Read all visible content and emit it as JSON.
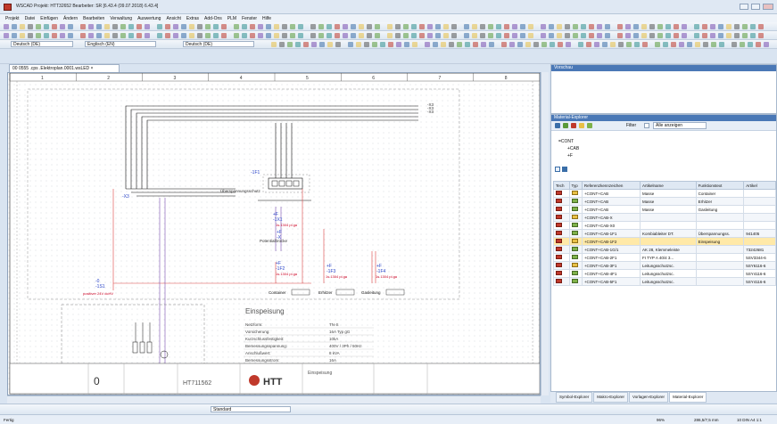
{
  "window": {
    "title": "WSCAD Projekt: HTT32652  Bearbeiter: SR [6.43.4 (09.07.2018) 6.43.4]"
  },
  "menu": [
    "Projekt",
    "Datei",
    "Einfügen",
    "Ändern",
    "Bearbeiten",
    "Verwaltung",
    "Auswertung",
    "Ansicht",
    "Extras",
    "Add-Ons",
    "PLM",
    "Fenster",
    "Hilfe"
  ],
  "toolbar": {
    "lang1": "Deutsch (DE)",
    "lang2": "Englisch (EN)",
    "lang3": "Deutsch (DE)",
    "style": "Standard"
  },
  "doc_tab": {
    "label": "00 0555 .cps .Elektroplan.0001.wsLED ×"
  },
  "column_numbers": [
    "1",
    "2",
    "3",
    "4",
    "5",
    "6",
    "7",
    "8"
  ],
  "schematic": {
    "cabinet_label": "Überspannungsschutz",
    "potential_label": "Potentialbrücke",
    "labels": [
      "-X3",
      "-1F1",
      "-1F2",
      "-1F3",
      "-1F4",
      "-10",
      "-X",
      "+F",
      "+F1",
      "+F2",
      "Container",
      "Erhitzer",
      "Gasleitung"
    ],
    "terminal_text": "positiver 24V dcHV",
    "cross_refs": [
      "1s.1304 pl.ga",
      "1s.1304 pl.ga",
      "1s.1304 pl.ga"
    ],
    "legend_title": "Einspeisung",
    "legend_rows": [
      {
        "k": "Netzform:",
        "v": "TN-S"
      },
      {
        "k": "Vorsicherung:",
        "v": "16A  Typ gG"
      },
      {
        "k": "Kurzschlussfestigkeit:",
        "v": "10kA"
      },
      {
        "k": "Bemessungsspannung:",
        "v": "400V / 3Ph / 50Hz"
      },
      {
        "k": "Anschlußwert:",
        "v": "8 kVA"
      },
      {
        "k": "Bemessungsstrom:",
        "v": "16A"
      }
    ],
    "titleblock": {
      "drawing_no": "HT711562",
      "rev": "0",
      "company": "HTT",
      "doc": "Einspeisung"
    }
  },
  "panels": {
    "preview": {
      "title": "Vorschau"
    },
    "material": {
      "title": "Material-Explorer",
      "filter_label": "Filter",
      "show_all": "Alle anzeigen",
      "tree": [
        "=CONT",
        "+CAB",
        "+F"
      ],
      "columns": [
        "Tech",
        "Typ",
        "Referenzkennzeichen",
        "Artikelname",
        "Funktionstext",
        "Artikel"
      ],
      "rows": [
        {
          "ref": "+CONT+CAB",
          "name": "Masse",
          "func": "Container",
          "art": ""
        },
        {
          "ref": "+CONT+CAB",
          "name": "Masse",
          "func": "Erhitzer",
          "art": ""
        },
        {
          "ref": "+CONT+CAB",
          "name": "Masse",
          "func": "Gasleitung",
          "art": ""
        },
        {
          "ref": "+CONT+CAB-X",
          "name": "",
          "func": "",
          "art": ""
        },
        {
          "ref": "+CONT+CAB-X0",
          "name": "",
          "func": "",
          "art": ""
        },
        {
          "ref": "+CONT+CAB-1F1",
          "name": "Kombiableiter DT.",
          "func": "Überspannungss.",
          "art": "941405"
        },
        {
          "ref": "+CONT+CAB-1F2",
          "name": "",
          "func": "Einspeisung",
          "art": ""
        },
        {
          "ref": "+CONT+CAB-1G/1",
          "name": "AK 28, Klemmeleiste",
          "func": "",
          "art": "73242681"
        },
        {
          "ref": "+CONT+CAB-2F1",
          "name": "FI TYP A 40/4 3...",
          "func": "",
          "art": "5SV3344-6"
        },
        {
          "ref": "+CONT+CAB-3F1",
          "name": "Leitungsschutzsc.",
          "func": "",
          "art": "5SY6116-6"
        },
        {
          "ref": "+CONT+CAB-4F1",
          "name": "Leitungsschutzsc.",
          "func": "",
          "art": "5SY4116-6"
        },
        {
          "ref": "+CONT+CAB-5F1",
          "name": "Leitungsschutzsc.",
          "func": "",
          "art": "5SY4116-6"
        }
      ]
    }
  },
  "bottom_tabs": [
    "Symbol-Explorer",
    "Makro-Explorer",
    "Vorlagen-Explorer",
    "Material-Explorer"
  ],
  "status": {
    "left": "Fertig",
    "zoom": "96%",
    "coords": "286,5/7,5 mm",
    "sheet": "10  DIN A4  1:1"
  }
}
